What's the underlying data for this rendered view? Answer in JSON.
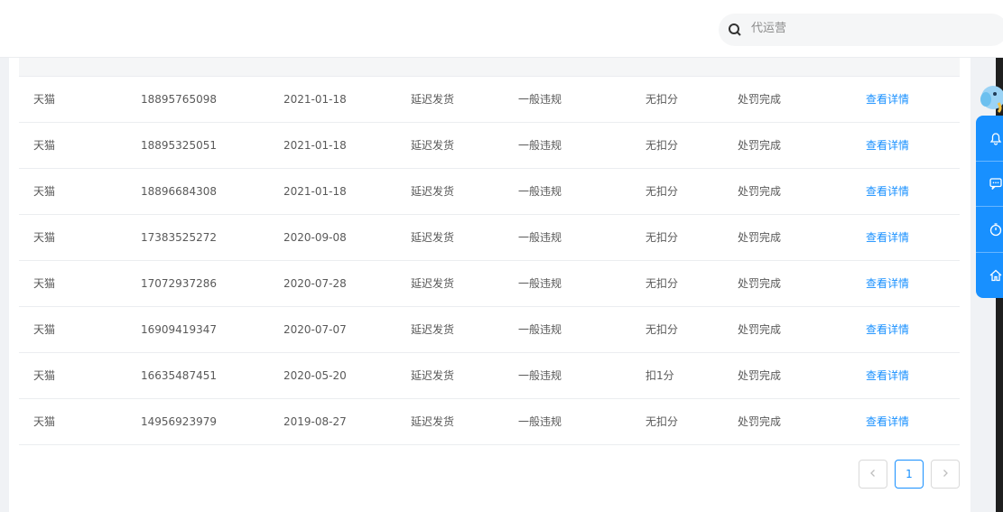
{
  "search": {
    "placeholder": "代运营"
  },
  "table": {
    "rows": [
      {
        "platform": "天猫",
        "order_id": "18895765098",
        "date": "2021-01-18",
        "type": "延迟发货",
        "level": "一般违规",
        "deduction": "无扣分",
        "status": "处罚完成",
        "action": "查看详情"
      },
      {
        "platform": "天猫",
        "order_id": "18895325051",
        "date": "2021-01-18",
        "type": "延迟发货",
        "level": "一般违规",
        "deduction": "无扣分",
        "status": "处罚完成",
        "action": "查看详情"
      },
      {
        "platform": "天猫",
        "order_id": "18896684308",
        "date": "2021-01-18",
        "type": "延迟发货",
        "level": "一般违规",
        "deduction": "无扣分",
        "status": "处罚完成",
        "action": "查看详情"
      },
      {
        "platform": "天猫",
        "order_id": "17383525272",
        "date": "2020-09-08",
        "type": "延迟发货",
        "level": "一般违规",
        "deduction": "无扣分",
        "status": "处罚完成",
        "action": "查看详情"
      },
      {
        "platform": "天猫",
        "order_id": "17072937286",
        "date": "2020-07-28",
        "type": "延迟发货",
        "level": "一般违规",
        "deduction": "无扣分",
        "status": "处罚完成",
        "action": "查看详情"
      },
      {
        "platform": "天猫",
        "order_id": "16909419347",
        "date": "2020-07-07",
        "type": "延迟发货",
        "level": "一般违规",
        "deduction": "无扣分",
        "status": "处罚完成",
        "action": "查看详情"
      },
      {
        "platform": "天猫",
        "order_id": "16635487451",
        "date": "2020-05-20",
        "type": "延迟发货",
        "level": "一般违规",
        "deduction": "扣1分",
        "status": "处罚完成",
        "action": "查看详情"
      },
      {
        "platform": "天猫",
        "order_id": "14956923979",
        "date": "2019-08-27",
        "type": "延迟发货",
        "level": "一般违规",
        "deduction": "无扣分",
        "status": "处罚完成",
        "action": "查看详情"
      }
    ]
  },
  "pagination": {
    "prev_icon": "chevron-left-icon",
    "current_page": "1",
    "next_icon": "chevron-right-icon"
  },
  "float_toolbar": {
    "items": [
      "bell-icon",
      "chat-icon",
      "timer-icon",
      "home-icon"
    ]
  },
  "colors": {
    "accent": "#1890ff",
    "link": "#1890ff",
    "text": "#595959",
    "border": "#ebedf0"
  }
}
